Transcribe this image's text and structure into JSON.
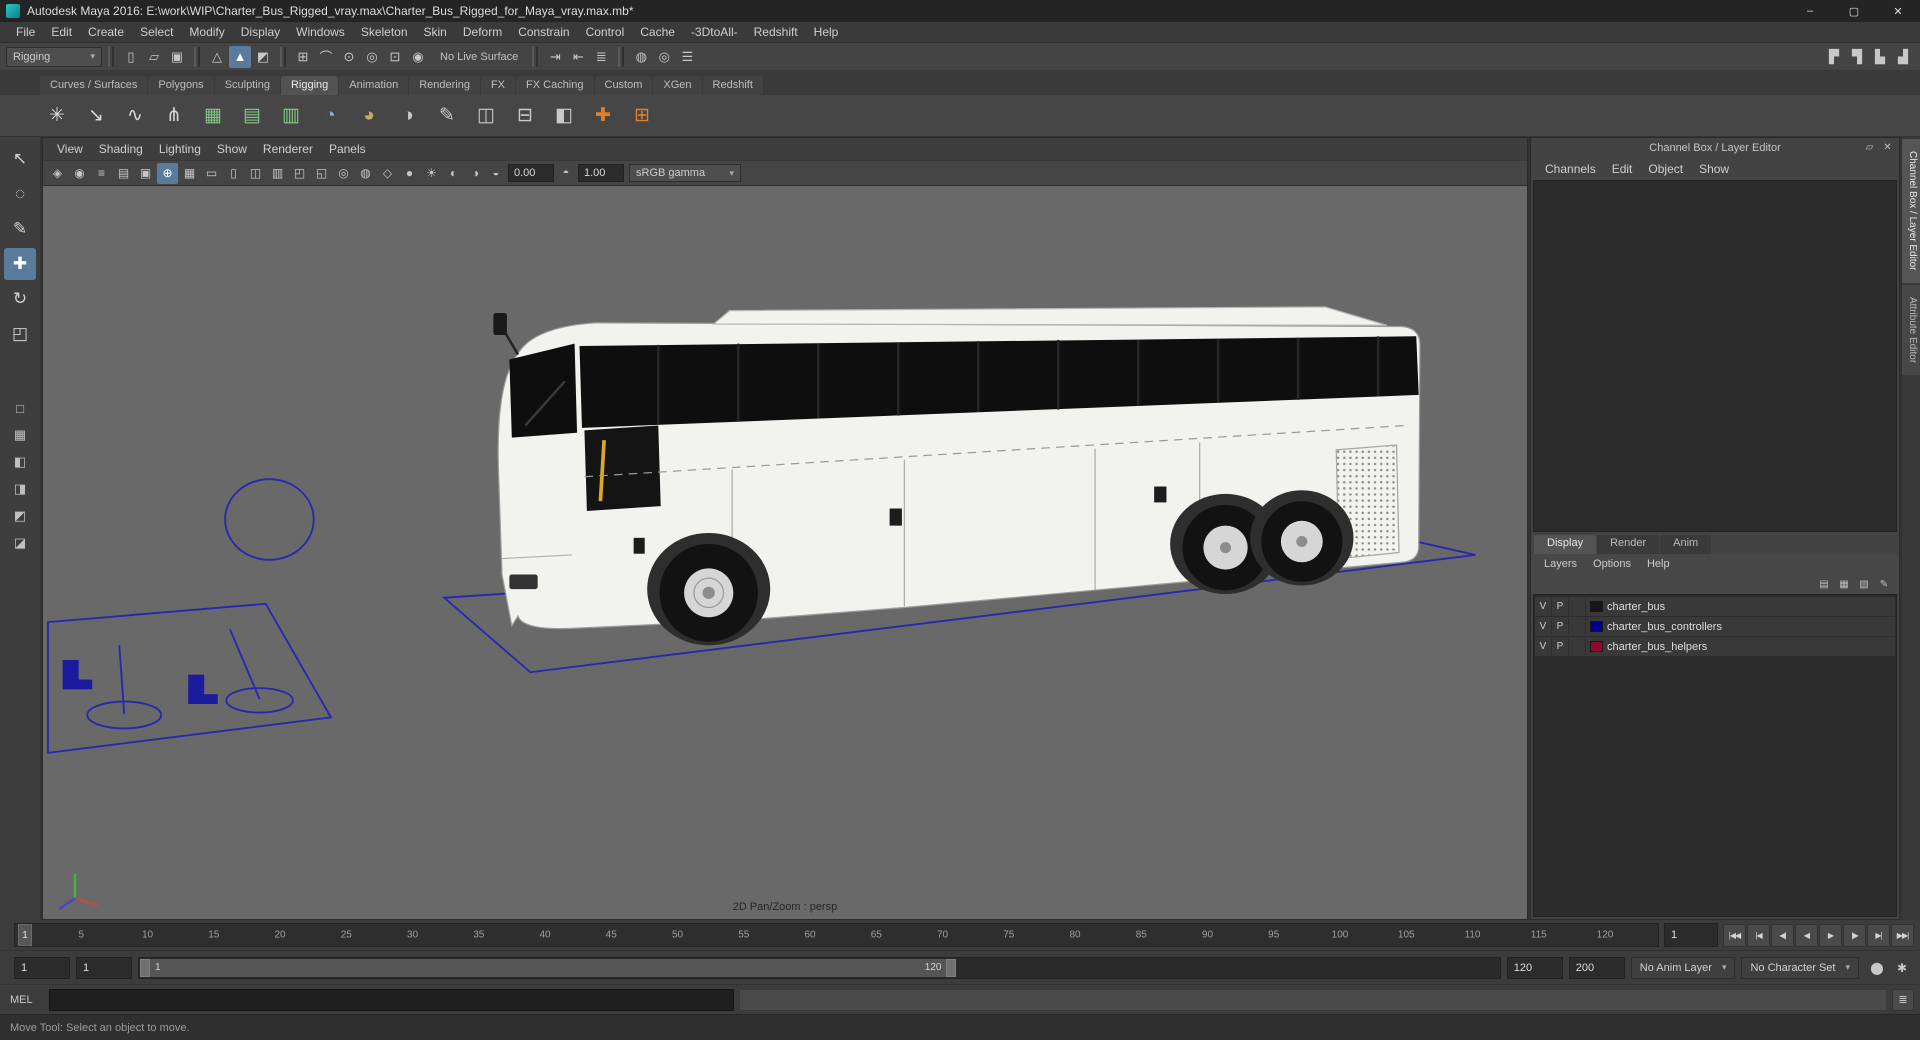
{
  "colors": {
    "accent": "#5b7b9d",
    "viewport_bg": "#696969",
    "controller_blue": "#2727b2",
    "bus_body": "#f2f2ef",
    "bus_glass": "#0e0e0e"
  },
  "title_bar": {
    "title": "Autodesk Maya 2016: E:\\work\\WIP\\Charter_Bus_Rigged_vray.max\\Charter_Bus_Rigged_for_Maya_vray.max.mb*",
    "controls": [
      {
        "name": "minimize-button",
        "glyph": "–"
      },
      {
        "name": "maximize-button",
        "glyph": "▢"
      },
      {
        "name": "close-button",
        "glyph": "✕"
      }
    ]
  },
  "menu_bar": {
    "items": [
      "File",
      "Edit",
      "Create",
      "Select",
      "Modify",
      "Display",
      "Windows",
      "Skeleton",
      "Skin",
      "Deform",
      "Constrain",
      "Control",
      "Cache",
      "-3DtoAll-",
      "Redshift",
      "Help"
    ]
  },
  "status_line": {
    "menu_set": "Rigging",
    "no_live_surface": "No Live Surface",
    "file_icons": [
      {
        "name": "new-scene-icon",
        "glyph": "▯"
      },
      {
        "name": "open-scene-icon",
        "glyph": "▱"
      },
      {
        "name": "save-scene-icon",
        "glyph": "▣"
      }
    ],
    "selection_icons": [
      {
        "name": "select-by-hierarchy-icon",
        "glyph": "△"
      },
      {
        "name": "select-by-object-icon",
        "glyph": "▲",
        "active": true
      },
      {
        "name": "select-by-component-icon",
        "glyph": "◩"
      }
    ],
    "snap_icons": [
      {
        "name": "snap-to-grids-icon",
        "glyph": "⊞"
      },
      {
        "name": "snap-to-curves-icon",
        "glyph": "⌒"
      },
      {
        "name": "snap-to-points-icon",
        "glyph": "⊙"
      },
      {
        "name": "snap-to-projected-center-icon",
        "glyph": "◎"
      },
      {
        "name": "snap-to-view-planes-icon",
        "glyph": "⊡"
      },
      {
        "name": "make-object-live-icon",
        "glyph": "◉"
      }
    ],
    "history_icons": [
      {
        "name": "input-connections-icon",
        "glyph": "⇥"
      },
      {
        "name": "output-connections-icon",
        "glyph": "⇤"
      },
      {
        "name": "construction-history-icon",
        "glyph": "≣"
      }
    ],
    "render_icons": [
      {
        "name": "render-current-frame-icon",
        "glyph": "◍"
      },
      {
        "name": "ipr-render-icon",
        "glyph": "◎"
      },
      {
        "name": "render-settings-icon",
        "glyph": "☰"
      }
    ],
    "sidebar_icons": [
      {
        "name": "modeling-toolkit-icon",
        "glyph": "▛"
      },
      {
        "name": "attribute-editor-toggle-icon",
        "glyph": "▜"
      },
      {
        "name": "tool-settings-toggle-icon",
        "glyph": "▙"
      },
      {
        "name": "channel-box-toggle-icon",
        "glyph": "▟"
      }
    ]
  },
  "shelf": {
    "tabs": [
      {
        "label": "Curves / Surfaces"
      },
      {
        "label": "Polygons"
      },
      {
        "label": "Sculpting"
      },
      {
        "label": "Rigging",
        "active": true
      },
      {
        "label": "Animation"
      },
      {
        "label": "Rendering"
      },
      {
        "label": "FX"
      },
      {
        "label": "FX Caching"
      },
      {
        "label": "Custom"
      },
      {
        "label": "XGen"
      },
      {
        "label": "Redshift"
      }
    ],
    "icons": [
      {
        "name": "create-joint-icon",
        "glyph": "✳",
        "color": "#d9d9d9"
      },
      {
        "name": "ik-handle-icon",
        "glyph": "↘",
        "color": "#d9d9d9"
      },
      {
        "name": "ik-spline-handle-icon",
        "glyph": "∿",
        "color": "#d9d9d9"
      },
      {
        "name": "insert-joint-icon",
        "glyph": "⋔",
        "color": "#d9d9d9"
      },
      {
        "name": "hik-character-icon",
        "glyph": "▦",
        "color": "#86c786"
      },
      {
        "name": "hik-control-rig-icon",
        "glyph": "▤",
        "color": "#86c786"
      },
      {
        "name": "hik-skeleton-icon",
        "glyph": "▥",
        "color": "#86c786"
      },
      {
        "name": "create-control-circle-icon",
        "glyph": "◔",
        "color": "#7fb6d9"
      },
      {
        "name": "smooth-bind-icon",
        "glyph": "◕",
        "color": "#c9a86a"
      },
      {
        "name": "rigid-bind-icon",
        "glyph": "◑",
        "color": "#c9c9c9"
      },
      {
        "name": "paint-skin-weights-icon",
        "glyph": "✎",
        "color": "#c9c9c9"
      },
      {
        "name": "mirror-skin-weights-icon",
        "glyph": "◫",
        "color": "#c9c9c9"
      },
      {
        "name": "copy-skin-weights-icon",
        "glyph": "⊟",
        "color": "#c9c9c9"
      },
      {
        "name": "blend-shape-icon",
        "glyph": "◧",
        "color": "#c9c9c9"
      },
      {
        "name": "plugin-add-rig-icon",
        "glyph": "✚",
        "color": "#e0802f"
      },
      {
        "name": "plugin-bracket-rig-icon",
        "glyph": "⊞",
        "color": "#e0802f"
      }
    ]
  },
  "toolbox": {
    "tools": [
      {
        "name": "select-tool-button",
        "glyph": "↖"
      },
      {
        "name": "lasso-select-tool-button",
        "glyph": "◌"
      },
      {
        "name": "paint-select-tool-button",
        "glyph": "✎"
      },
      {
        "name": "move-tool-button",
        "glyph": "✚",
        "active": true
      },
      {
        "name": "rotate-tool-button",
        "glyph": "↻"
      },
      {
        "name": "scale-tool-button",
        "glyph": "◰"
      }
    ],
    "layouts": [
      {
        "name": "layout-single-pane-button",
        "glyph": "□"
      },
      {
        "name": "layout-four-pane-button",
        "glyph": "▦"
      },
      {
        "name": "layout-persp-outliner-button",
        "glyph": "◧"
      },
      {
        "name": "layout-two-pane-side-button",
        "glyph": "◨"
      },
      {
        "name": "layout-persp-graph-button",
        "glyph": "◩"
      },
      {
        "name": "layout-hypershade-persp-button",
        "glyph": "◪"
      }
    ]
  },
  "viewport": {
    "menus": [
      "View",
      "Shading",
      "Lighting",
      "Show",
      "Renderer",
      "Panels"
    ],
    "icons": [
      {
        "name": "select-camera-icon",
        "glyph": "◈"
      },
      {
        "name": "lock-camera-icon",
        "glyph": "◉"
      },
      {
        "name": "camera-attributes-icon",
        "glyph": "≡"
      },
      {
        "name": "bookmarks-icon",
        "glyph": "▤"
      },
      {
        "name": "image-plane-icon",
        "glyph": "▣"
      },
      {
        "name": "2d-pan-zoom-icon",
        "glyph": "⊕",
        "active": true
      },
      {
        "name": "grid-icon",
        "glyph": "▦"
      },
      {
        "name": "film-gate-icon",
        "glyph": "▭"
      },
      {
        "name": "resolution-gate-icon",
        "glyph": "▯"
      },
      {
        "name": "gate-mask-icon",
        "glyph": "◫"
      },
      {
        "name": "field-chart-icon",
        "glyph": "▥"
      },
      {
        "name": "safe-action-icon",
        "glyph": "◰"
      },
      {
        "name": "safe-title-icon",
        "glyph": "◱"
      },
      {
        "name": "isolate-select-icon",
        "glyph": "◎"
      },
      {
        "name": "xray-icon",
        "glyph": "◍"
      },
      {
        "name": "wireframe-on-shaded-icon",
        "glyph": "◇"
      },
      {
        "name": "default-material-icon",
        "glyph": "●"
      },
      {
        "name": "lights-icon",
        "glyph": "☀"
      },
      {
        "name": "shadows-icon",
        "glyph": "◐"
      },
      {
        "name": "screen-space-ao-icon",
        "glyph": "◑"
      }
    ],
    "exposure": {
      "icon": "◒",
      "value": "0.00"
    },
    "gamma": {
      "icon": "◓",
      "value": "1.00"
    },
    "color_profile": "sRGB gamma",
    "overlay_text": "2D Pan/Zoom : persp"
  },
  "channel_box": {
    "panel_title": "Channel Box / Layer Editor",
    "header_icons": [
      {
        "name": "undock-panel-icon",
        "glyph": "▱"
      },
      {
        "name": "close-panel-icon",
        "glyph": "✕"
      }
    ],
    "menus": [
      "Channels",
      "Edit",
      "Object",
      "Show"
    ],
    "layer_editor": {
      "tabs": [
        {
          "label": "Display",
          "active": true
        },
        {
          "label": "Render"
        },
        {
          "label": "Anim"
        }
      ],
      "menus": [
        "Layers",
        "Options",
        "Help"
      ],
      "icons": [
        {
          "name": "layer-list-icon",
          "glyph": "▤"
        },
        {
          "name": "create-empty-layer-icon",
          "glyph": "▦"
        },
        {
          "name": "create-layer-from-selected-icon",
          "glyph": "▧"
        },
        {
          "name": "layer-attributes-icon",
          "glyph": "✎"
        }
      ],
      "layers": [
        {
          "v": "V",
          "p": "P",
          "color": "#161616",
          "name": "charter_bus"
        },
        {
          "v": "V",
          "p": "P",
          "color": "#000089",
          "name": "charter_bus_controllers"
        },
        {
          "v": "V",
          "p": "P",
          "color": "#8b0a2e",
          "name": "charter_bus_helpers"
        }
      ]
    }
  },
  "sidebar_tabs": [
    {
      "label": "Channel Box / Layer Editor",
      "active": true
    },
    {
      "label": "Attribute Editor"
    }
  ],
  "timeline": {
    "ticks": [
      "5",
      "10",
      "15",
      "20",
      "25",
      "30",
      "35",
      "40",
      "45",
      "50",
      "55",
      "60",
      "65",
      "70",
      "75",
      "80",
      "85",
      "90",
      "95",
      "100",
      "105",
      "110",
      "115",
      "120"
    ],
    "current_frame": "1",
    "frame_field": "1",
    "playback": [
      {
        "name": "go-to-start-button",
        "glyph": "|◀◀"
      },
      {
        "name": "step-back-frame-button",
        "glyph": "|◀"
      },
      {
        "name": "step-back-key-button",
        "glyph": "◀|"
      },
      {
        "name": "play-backwards-button",
        "glyph": "◀"
      },
      {
        "name": "play-forwards-button",
        "glyph": "▶"
      },
      {
        "name": "step-forward-key-button",
        "glyph": "|▶"
      },
      {
        "name": "step-forward-frame-button",
        "glyph": "▶|"
      },
      {
        "name": "go-to-end-button",
        "glyph": "▶▶|"
      }
    ]
  },
  "range_slider": {
    "animation_start": "1",
    "playback_start": "1",
    "range_start_label": "1",
    "range_end_label": "120",
    "playback_end": "120",
    "animation_end": "200",
    "anim_layer": "No Anim Layer",
    "character_set": "No Character Set",
    "icons": [
      {
        "name": "auto-keyframe-button",
        "glyph": "⬤"
      },
      {
        "name": "animation-preferences-button",
        "glyph": "✱"
      }
    ]
  },
  "command_line": {
    "label": "MEL"
  },
  "help_line": {
    "text": "Move Tool: Select an object to move."
  }
}
